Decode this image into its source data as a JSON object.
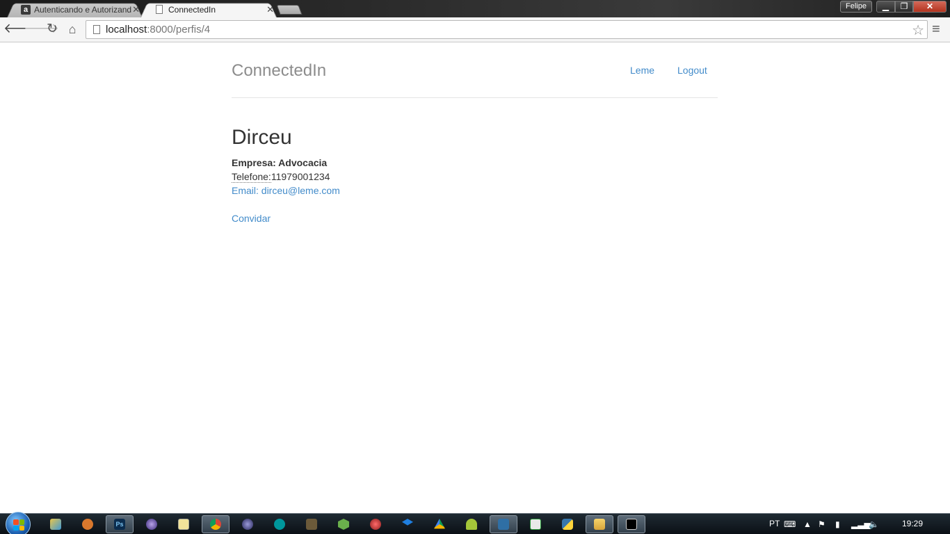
{
  "browser": {
    "tabs": [
      {
        "title": "Autenticando e Autorizand",
        "favicon": "a"
      },
      {
        "title": "ConnectedIn"
      }
    ],
    "profile_name": "Felipe",
    "window_buttons": {
      "minimize": "▁",
      "maximize": "❐",
      "close": "✕"
    },
    "url_host": "localhost",
    "url_rest": ":8000/perfis/4"
  },
  "site": {
    "brand": "ConnectedIn",
    "nav": [
      {
        "label": "Leme"
      },
      {
        "label": "Logout"
      }
    ]
  },
  "profile": {
    "name": "Dirceu",
    "company": "Empresa: Advocacia",
    "phone_label": "Telefone:",
    "phone_value": "11979001234",
    "email": "Email: dirceu@leme.com",
    "invite_label": "Convidar"
  },
  "taskbar": {
    "apps": [
      "file-manager",
      "gimp",
      "photoshop",
      "eclipse",
      "notepad",
      "chrome",
      "eclipse-2",
      "arduino",
      "terminal-app",
      "android-studio",
      "network-tool",
      "dropbox",
      "google-drive",
      "android",
      "sql-tool",
      "sync-tool",
      "python",
      "explorer",
      "cmd"
    ],
    "language": "PT",
    "clock": "19:29",
    "photoshop_label": "Ps"
  },
  "colors": {
    "link": "#428bca",
    "brand_text": "#8c8c8c",
    "body_text": "#333333"
  }
}
